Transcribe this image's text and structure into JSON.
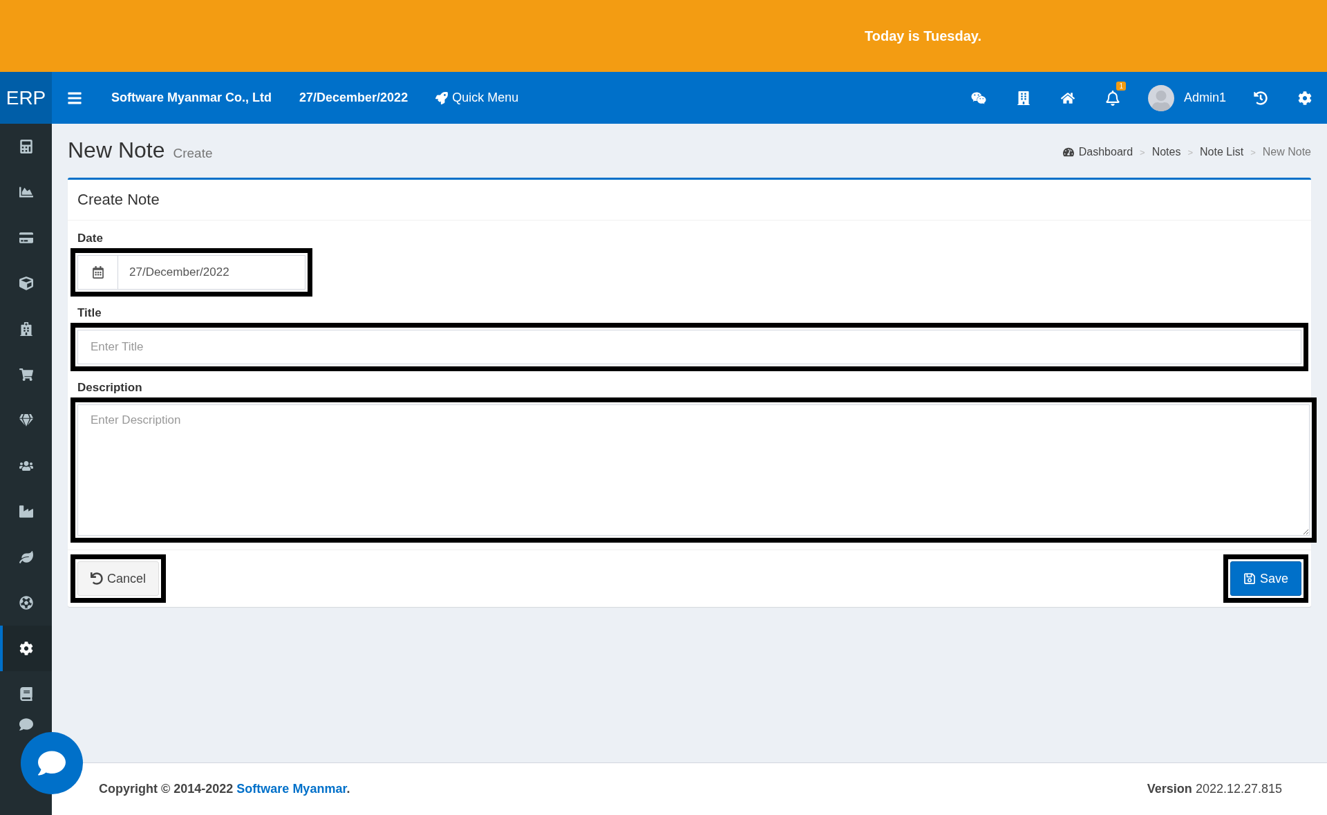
{
  "banner": {
    "text": "Today is Tuesday."
  },
  "navbar": {
    "logo": "ERP",
    "company": "Software Myanmar Co., Ltd",
    "date": "27/December/2022",
    "quick_menu": "Quick Menu",
    "notification_count": "1",
    "user": "Admin1"
  },
  "sidebar": {
    "items": [
      {
        "selected": false
      },
      {
        "selected": false
      },
      {
        "selected": false
      },
      {
        "selected": false
      },
      {
        "selected": false
      },
      {
        "selected": false
      },
      {
        "selected": false
      },
      {
        "selected": false
      },
      {
        "selected": false
      },
      {
        "selected": false
      },
      {
        "selected": false
      },
      {
        "selected": true
      },
      {
        "selected": false
      },
      {
        "selected": false
      }
    ]
  },
  "page": {
    "title": "New Note",
    "subtitle": "Create"
  },
  "breadcrumb": [
    {
      "label": "Dashboard",
      "current": false
    },
    {
      "label": "Notes",
      "current": false
    },
    {
      "label": "Note List",
      "current": false
    },
    {
      "label": "New Note",
      "current": true
    }
  ],
  "breadcrumb_separator": ">",
  "form": {
    "title": "Create Note",
    "fields": [
      {
        "kind": "date",
        "label": "Date",
        "value": "27/December/2022",
        "highlighted": true
      },
      {
        "kind": "text",
        "label": "Title",
        "placeholder": "Enter Title",
        "highlighted": true
      },
      {
        "kind": "textarea",
        "label": "Description",
        "placeholder": "Enter Description",
        "highlighted": true
      }
    ],
    "buttons": [
      {
        "kind": "cancel",
        "label": "Cancel",
        "highlighted": true
      },
      {
        "kind": "save",
        "label": "Save",
        "highlighted": true
      }
    ]
  },
  "footer": {
    "copyright": "Copyright © 2014-2022",
    "link": "Software Myanmar",
    "link_suffix": ".",
    "version_label": "Version",
    "version": "2022.12.27.815"
  }
}
